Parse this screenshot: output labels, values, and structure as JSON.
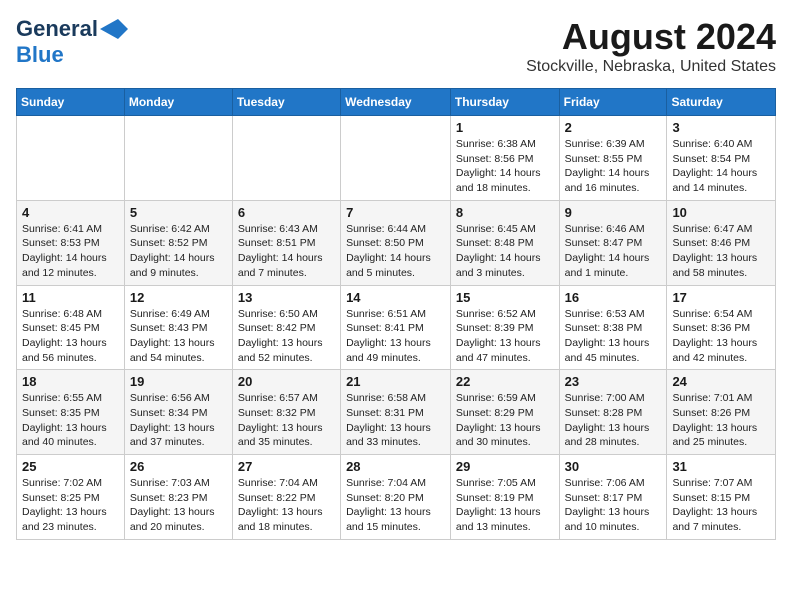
{
  "logo": {
    "line1": "General",
    "line2": "Blue"
  },
  "title": "August 2024",
  "subtitle": "Stockville, Nebraska, United States",
  "headers": [
    "Sunday",
    "Monday",
    "Tuesday",
    "Wednesday",
    "Thursday",
    "Friday",
    "Saturday"
  ],
  "weeks": [
    [
      {
        "num": "",
        "info": ""
      },
      {
        "num": "",
        "info": ""
      },
      {
        "num": "",
        "info": ""
      },
      {
        "num": "",
        "info": ""
      },
      {
        "num": "1",
        "info": "Sunrise: 6:38 AM\nSunset: 8:56 PM\nDaylight: 14 hours\nand 18 minutes."
      },
      {
        "num": "2",
        "info": "Sunrise: 6:39 AM\nSunset: 8:55 PM\nDaylight: 14 hours\nand 16 minutes."
      },
      {
        "num": "3",
        "info": "Sunrise: 6:40 AM\nSunset: 8:54 PM\nDaylight: 14 hours\nand 14 minutes."
      }
    ],
    [
      {
        "num": "4",
        "info": "Sunrise: 6:41 AM\nSunset: 8:53 PM\nDaylight: 14 hours\nand 12 minutes."
      },
      {
        "num": "5",
        "info": "Sunrise: 6:42 AM\nSunset: 8:52 PM\nDaylight: 14 hours\nand 9 minutes."
      },
      {
        "num": "6",
        "info": "Sunrise: 6:43 AM\nSunset: 8:51 PM\nDaylight: 14 hours\nand 7 minutes."
      },
      {
        "num": "7",
        "info": "Sunrise: 6:44 AM\nSunset: 8:50 PM\nDaylight: 14 hours\nand 5 minutes."
      },
      {
        "num": "8",
        "info": "Sunrise: 6:45 AM\nSunset: 8:48 PM\nDaylight: 14 hours\nand 3 minutes."
      },
      {
        "num": "9",
        "info": "Sunrise: 6:46 AM\nSunset: 8:47 PM\nDaylight: 14 hours\nand 1 minute."
      },
      {
        "num": "10",
        "info": "Sunrise: 6:47 AM\nSunset: 8:46 PM\nDaylight: 13 hours\nand 58 minutes."
      }
    ],
    [
      {
        "num": "11",
        "info": "Sunrise: 6:48 AM\nSunset: 8:45 PM\nDaylight: 13 hours\nand 56 minutes."
      },
      {
        "num": "12",
        "info": "Sunrise: 6:49 AM\nSunset: 8:43 PM\nDaylight: 13 hours\nand 54 minutes."
      },
      {
        "num": "13",
        "info": "Sunrise: 6:50 AM\nSunset: 8:42 PM\nDaylight: 13 hours\nand 52 minutes."
      },
      {
        "num": "14",
        "info": "Sunrise: 6:51 AM\nSunset: 8:41 PM\nDaylight: 13 hours\nand 49 minutes."
      },
      {
        "num": "15",
        "info": "Sunrise: 6:52 AM\nSunset: 8:39 PM\nDaylight: 13 hours\nand 47 minutes."
      },
      {
        "num": "16",
        "info": "Sunrise: 6:53 AM\nSunset: 8:38 PM\nDaylight: 13 hours\nand 45 minutes."
      },
      {
        "num": "17",
        "info": "Sunrise: 6:54 AM\nSunset: 8:36 PM\nDaylight: 13 hours\nand 42 minutes."
      }
    ],
    [
      {
        "num": "18",
        "info": "Sunrise: 6:55 AM\nSunset: 8:35 PM\nDaylight: 13 hours\nand 40 minutes."
      },
      {
        "num": "19",
        "info": "Sunrise: 6:56 AM\nSunset: 8:34 PM\nDaylight: 13 hours\nand 37 minutes."
      },
      {
        "num": "20",
        "info": "Sunrise: 6:57 AM\nSunset: 8:32 PM\nDaylight: 13 hours\nand 35 minutes."
      },
      {
        "num": "21",
        "info": "Sunrise: 6:58 AM\nSunset: 8:31 PM\nDaylight: 13 hours\nand 33 minutes."
      },
      {
        "num": "22",
        "info": "Sunrise: 6:59 AM\nSunset: 8:29 PM\nDaylight: 13 hours\nand 30 minutes."
      },
      {
        "num": "23",
        "info": "Sunrise: 7:00 AM\nSunset: 8:28 PM\nDaylight: 13 hours\nand 28 minutes."
      },
      {
        "num": "24",
        "info": "Sunrise: 7:01 AM\nSunset: 8:26 PM\nDaylight: 13 hours\nand 25 minutes."
      }
    ],
    [
      {
        "num": "25",
        "info": "Sunrise: 7:02 AM\nSunset: 8:25 PM\nDaylight: 13 hours\nand 23 minutes."
      },
      {
        "num": "26",
        "info": "Sunrise: 7:03 AM\nSunset: 8:23 PM\nDaylight: 13 hours\nand 20 minutes."
      },
      {
        "num": "27",
        "info": "Sunrise: 7:04 AM\nSunset: 8:22 PM\nDaylight: 13 hours\nand 18 minutes."
      },
      {
        "num": "28",
        "info": "Sunrise: 7:04 AM\nSunset: 8:20 PM\nDaylight: 13 hours\nand 15 minutes."
      },
      {
        "num": "29",
        "info": "Sunrise: 7:05 AM\nSunset: 8:19 PM\nDaylight: 13 hours\nand 13 minutes."
      },
      {
        "num": "30",
        "info": "Sunrise: 7:06 AM\nSunset: 8:17 PM\nDaylight: 13 hours\nand 10 minutes."
      },
      {
        "num": "31",
        "info": "Sunrise: 7:07 AM\nSunset: 8:15 PM\nDaylight: 13 hours\nand 7 minutes."
      }
    ]
  ]
}
